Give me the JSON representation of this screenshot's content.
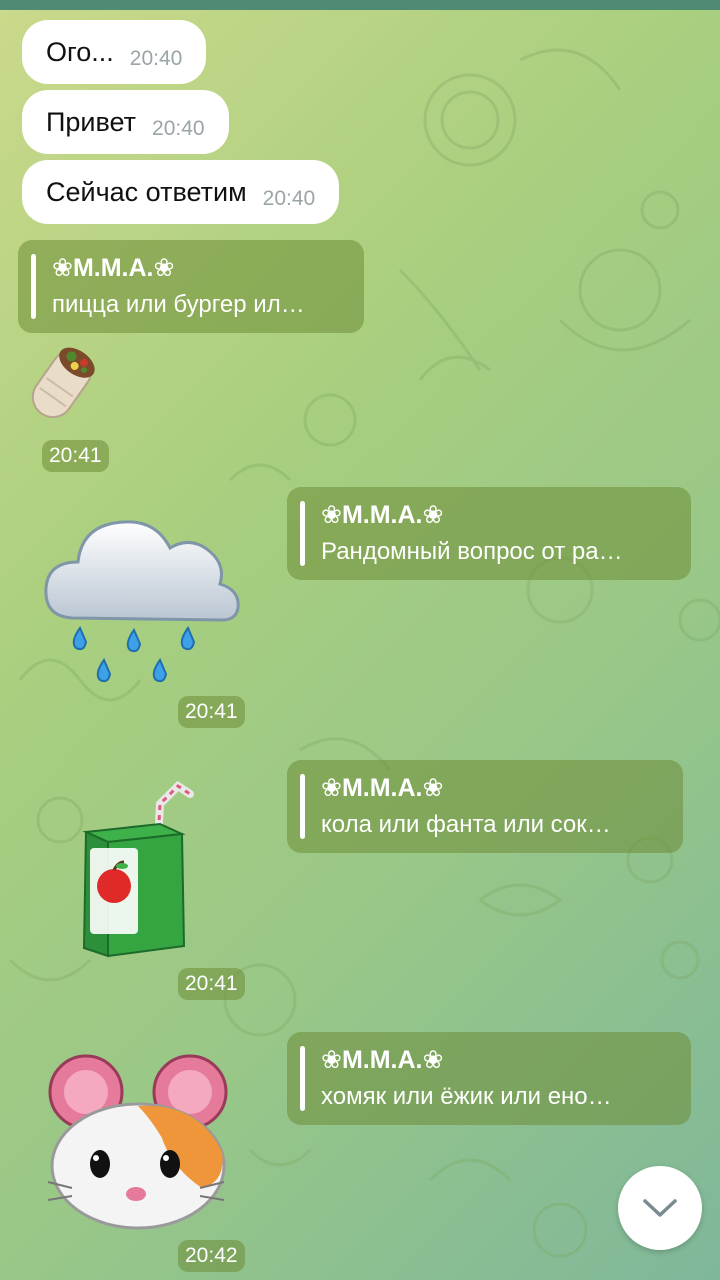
{
  "messages": [
    {
      "text": "Ого...",
      "time": "20:40"
    },
    {
      "text": "Привет",
      "time": "20:40"
    },
    {
      "text": "Сейчас ответим",
      "time": "20:40"
    }
  ],
  "replies": [
    {
      "name": "❀М.М.А.❀",
      "quote": "пицца или  бургер ил…"
    },
    {
      "name": "❀М.М.А.❀",
      "quote": "Рандомный вопрос от ра…"
    },
    {
      "name": "❀М.М.А.❀",
      "quote": "кола или  фанта или  сок…"
    },
    {
      "name": "❀М.М.А.❀",
      "quote": "хомяк или  ёжик или  ено…"
    }
  ],
  "stickers": [
    {
      "icon": "burrito-icon",
      "time": "20:41"
    },
    {
      "icon": "rain-cloud-icon",
      "time": "20:41"
    },
    {
      "icon": "juice-box-icon",
      "time": "20:41"
    },
    {
      "icon": "hamster-icon",
      "time": "20:42"
    }
  ],
  "colors": {
    "top_bar": "#4f8a72",
    "reply_bg": "#6e8c37",
    "bubble_bg": "#ffffff",
    "time_in_bubble": "#9aa5a8"
  },
  "scroll_button": {
    "icon": "chevron-down-icon"
  }
}
